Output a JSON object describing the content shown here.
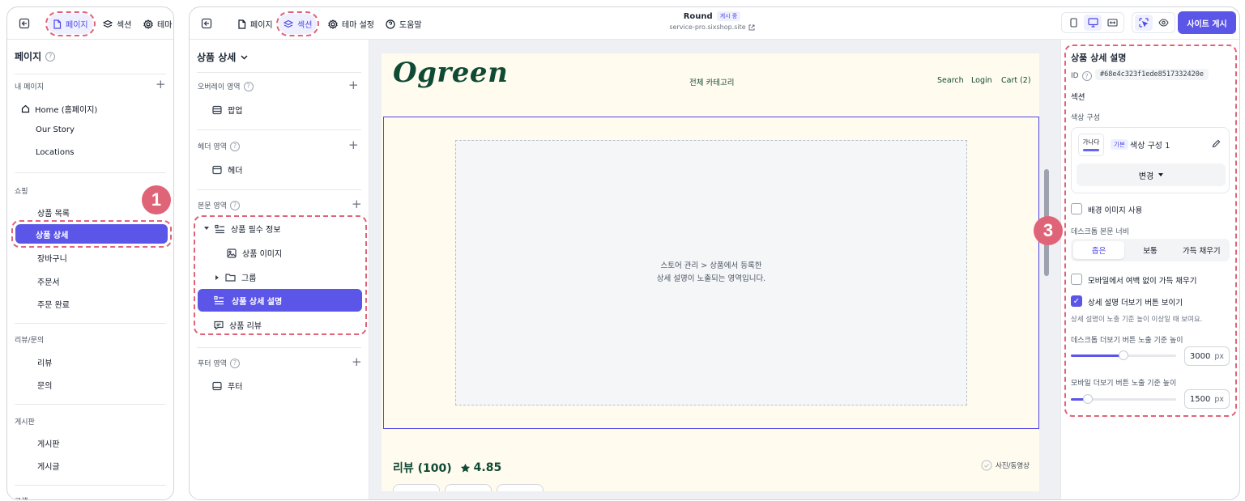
{
  "left": {
    "tabs": [
      {
        "label": "페이지",
        "icon": "page-icon",
        "active": true
      },
      {
        "label": "섹션",
        "icon": "layers-icon"
      },
      {
        "label": "테마",
        "icon": "settings-icon"
      }
    ],
    "title": "페이지",
    "groups": {
      "my_pages": {
        "label": "내 페이지",
        "items": [
          "Home (홈페이지)",
          "Our Story",
          "Locations"
        ]
      },
      "shopping": {
        "label": "쇼핑",
        "items": [
          "상품 목록",
          "상품 상세",
          "장바구니",
          "주문서",
          "주문 완료"
        ],
        "active": "상품 상세"
      },
      "reviews": {
        "label": "리뷰/문의",
        "items": [
          "리뷰",
          "문의"
        ]
      },
      "board": {
        "label": "게시판",
        "items": [
          "게시판",
          "게시글"
        ]
      },
      "next_group_label": "고객"
    },
    "badge": "1"
  },
  "header": {
    "tabs": [
      {
        "label": "페이지",
        "icon": "page-icon"
      },
      {
        "label": "섹션",
        "icon": "layers-icon",
        "active": true
      },
      {
        "label": "테마 설정",
        "icon": "settings-icon"
      },
      {
        "label": "도움말",
        "icon": "help-icon"
      }
    ],
    "site_name": "Round",
    "site_status": "게시 중",
    "site_url": "service-pro.sixshop.site",
    "publish_label": "사이트 게시"
  },
  "sections": {
    "page_title": "상품 상세",
    "overlay": {
      "label": "오버레이 영역",
      "items": [
        "팝업"
      ]
    },
    "header_area": {
      "label": "헤더 영역",
      "items": [
        "헤더"
      ]
    },
    "body_area": {
      "label": "본문 영역",
      "items": [
        "상품 필수 정보",
        "상품 이미지",
        "그룹",
        "상품 상세 설명",
        "상품 리뷰"
      ],
      "active": "상품 상세 설명"
    },
    "footer_area": {
      "label": "푸터 영역",
      "items": [
        "푸터"
      ]
    },
    "badge": "2"
  },
  "preview": {
    "logo": "Ogreen",
    "nav_center": "전체 카테고리",
    "nav_right": [
      "Search",
      "Login",
      "Cart (2)"
    ],
    "placeholder_lines": [
      "스토어 관리 > 상품에서 등록한",
      "상세 설명이 노출되는 영역입니다."
    ],
    "review_title": "리뷰 (100)",
    "rating": "4.85",
    "photo_filter": "사진/동영상"
  },
  "settings": {
    "title": "상품 상세 설명",
    "id_label": "ID",
    "id_value": "#68e4c323f1ede8517332420e",
    "section_label": "섹션",
    "color_config_label": "색상 구성",
    "swatch_text": "가나다",
    "basic_tag": "기본",
    "color_config_name": "색상 구성 1",
    "change_label": "변경",
    "bg_image_label": "배경 이미지 사용",
    "desktop_width_label": "데스크톱 본문 너비",
    "width_options": [
      "좁은",
      "보통",
      "가득 채우기"
    ],
    "width_selected": "좁은",
    "mobile_fill_label": "모바일에서 여백 없이 가득 채우기",
    "show_more_label": "상세 설명 더보기 버튼 보이기",
    "show_more_hint": "상세 설명이 노출 기준 높이 이상일 때 보여요.",
    "desktop_threshold_label": "데스크톱 더보기 버튼 노출 기준 높이",
    "desktop_threshold_value": "3000",
    "desktop_slider_fraction": 0.5,
    "mobile_threshold_label": "모바일 더보기 버튼 노출 기준 높이",
    "mobile_threshold_value": "1500",
    "mobile_slider_fraction": 0.16,
    "unit": "px",
    "badge": "3"
  },
  "colors": {
    "accent": "#5b55e8",
    "highlight": "#e06477",
    "brand_green": "#0f4a35"
  }
}
